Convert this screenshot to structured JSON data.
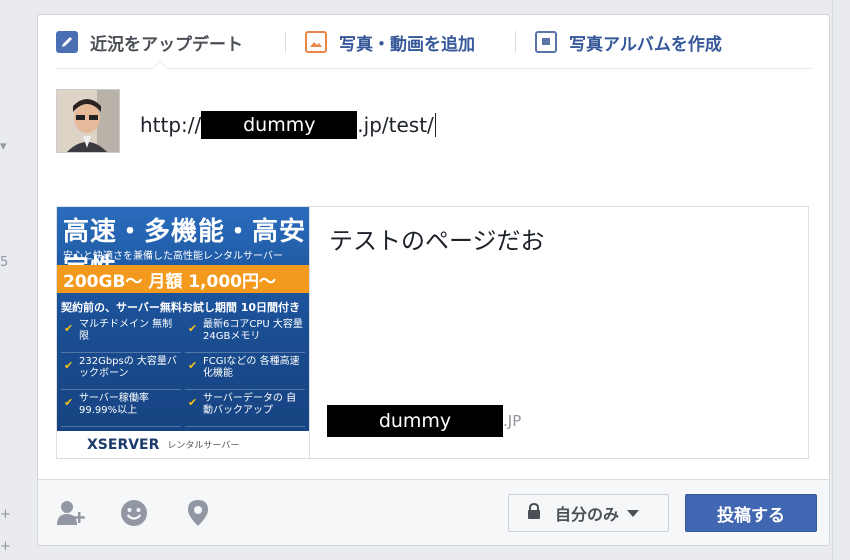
{
  "tabs": [
    {
      "label": "近況をアップデート",
      "icon": "pencil-icon"
    },
    {
      "label": "写真・動画を追加",
      "icon": "photo-icon"
    },
    {
      "label": "写真アルバムを作成",
      "icon": "album-icon"
    }
  ],
  "composer": {
    "url_prefix": "http://",
    "url_redacted": "dummy",
    "url_suffix": ".jp/test/"
  },
  "preview": {
    "title": "テストのページだお",
    "domain_redacted": "dummy",
    "domain_suffix": ".JP",
    "thumbnail": {
      "headline": "高速・多機能・高安定性",
      "subline": "安心と快適さを兼備した高性能レンタルサーバー",
      "price": "200GB〜  月額 1,000円〜",
      "trial": "契約前の、サーバー無料お試し期間 10日間付き",
      "features": [
        "マルチドメイン 無制限",
        "最新6コアCPU 大容量24GBメモリ",
        "232Gbpsの 大容量バックボーン",
        "FCGIなどの 各種高速化機能",
        "サーバー稼働率 99.99%以上",
        "サーバーデータの 自動バックアップ"
      ],
      "brand": "XSERVER",
      "brand_sub": "レンタルサーバー"
    }
  },
  "toolbar": {
    "privacy_label": "自分のみ",
    "post_label": "投稿する"
  },
  "colors": {
    "accent": "#4267b2",
    "link": "#365899",
    "background": "#e9ebee"
  }
}
